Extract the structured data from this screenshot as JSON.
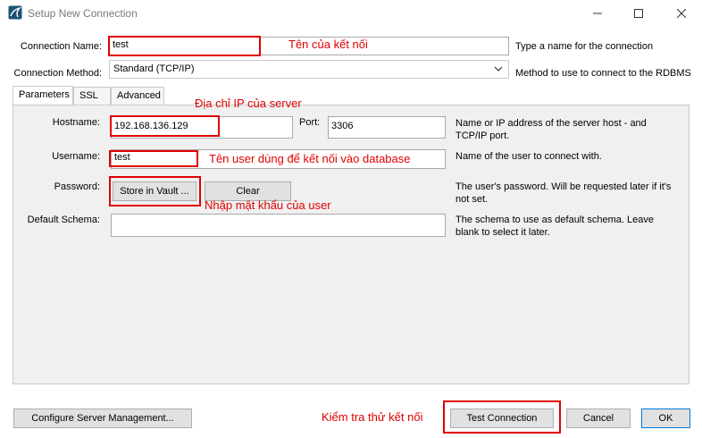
{
  "window": {
    "title": "Setup New Connection"
  },
  "connection": {
    "name_label": "Connection Name:",
    "name_value": "test",
    "name_desc": "Type a name for the connection",
    "method_label": "Connection Method:",
    "method_value": "Standard (TCP/IP)",
    "method_desc": "Method to use to connect to the RDBMS"
  },
  "tabs": [
    {
      "label": "Parameters",
      "active": true
    },
    {
      "label": "SSL",
      "active": false
    },
    {
      "label": "Advanced",
      "active": false
    }
  ],
  "parameters": {
    "hostname_label": "Hostname:",
    "hostname_value": "192.168.136.129",
    "port_label": "Port:",
    "port_value": "3306",
    "host_desc_line1": "Name or IP address of the server host - and",
    "host_desc_line2": "TCP/IP port.",
    "username_label": "Username:",
    "username_value": "test",
    "username_desc": "Name of the user to connect with.",
    "password_label": "Password:",
    "store_vault_label": "Store in Vault ...",
    "clear_label": "Clear",
    "password_desc_line1": "The user's password. Will be requested later if it's",
    "password_desc_line2": "not set.",
    "schema_label": "Default Schema:",
    "schema_value": "",
    "schema_desc_line1": "The schema to use as default schema. Leave",
    "schema_desc_line2": "blank to select it later."
  },
  "footer": {
    "configure_label": "Configure Server Management...",
    "test_label": "Test Connection",
    "cancel_label": "Cancel",
    "ok_label": "OK"
  },
  "annotations": {
    "connection_name": "Tên của kết nối",
    "server_ip": "Địa chỉ IP của server",
    "username": "Tên user dùng để kết nối vào database",
    "password": "Nhập mật khẩu của user",
    "test": "Kiểm tra thử kết nối"
  },
  "colors": {
    "annotation": "#e00000",
    "ok_border": "#0078d7",
    "panel_bg": "#f0f0f0"
  }
}
